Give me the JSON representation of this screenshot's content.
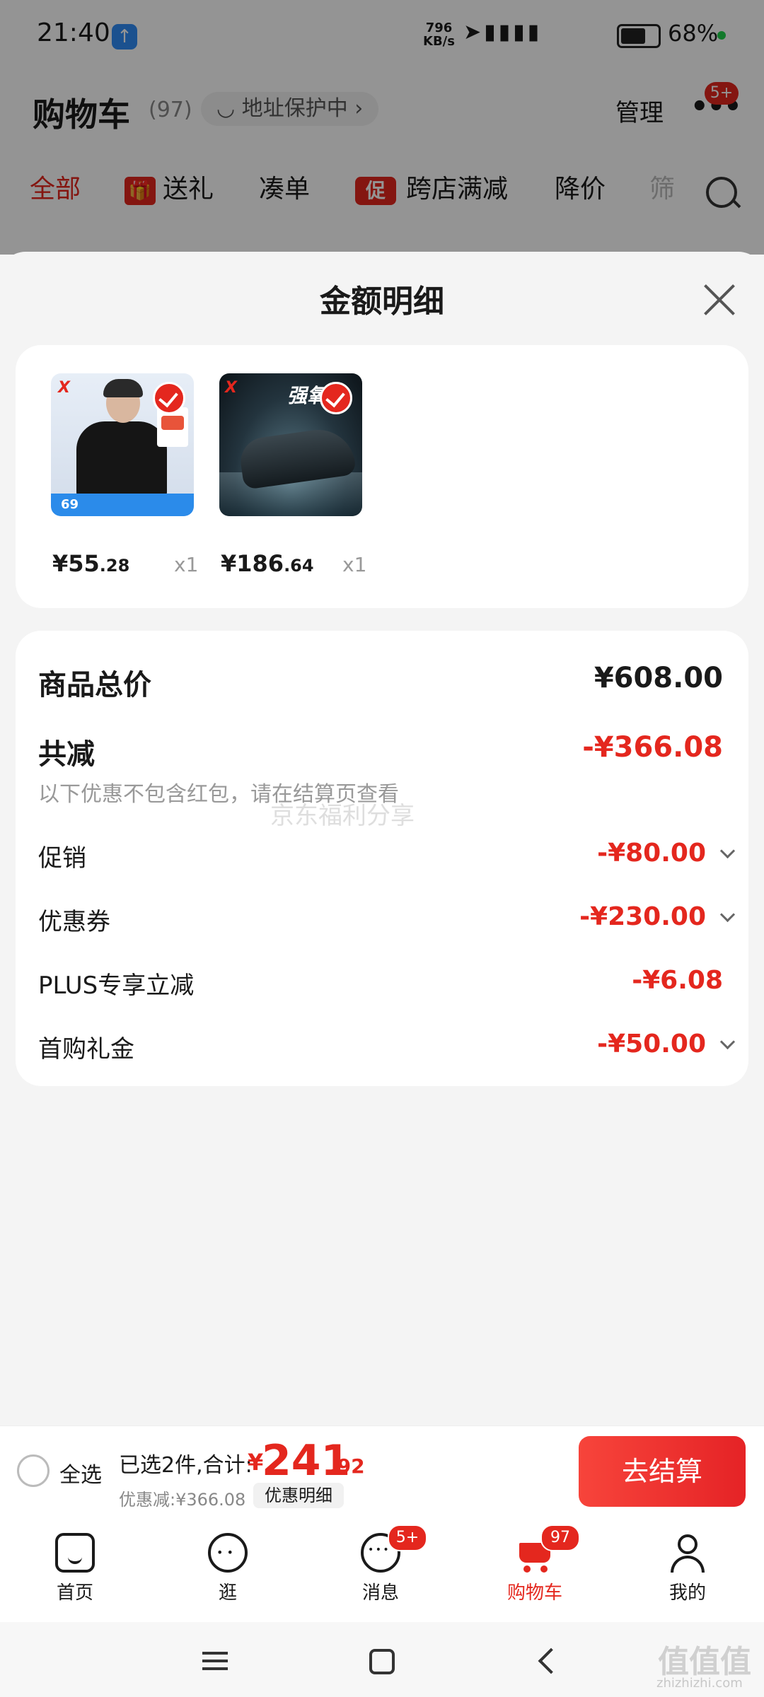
{
  "status_bar": {
    "time": "21:40",
    "net_speed_value": "796",
    "net_speed_unit": "KB/s",
    "battery": "68%"
  },
  "header": {
    "title": "购物车",
    "count": "(97)",
    "address": "地址保护中",
    "manage": "管理",
    "more_badge": "5+"
  },
  "tabs": [
    "全部",
    "送礼",
    "凑单",
    "跨店满减",
    "降价",
    "筛"
  ],
  "tab_icons": {
    "gift": "🎁",
    "promo": "促"
  },
  "sheet": {
    "title": "金额明细",
    "products": [
      {
        "price_int": "¥55",
        "price_dec": ".28",
        "qty": "x1",
        "logo": "X",
        "badge_num": "69"
      },
      {
        "price_int": "¥186",
        "price_dec": ".64",
        "qty": "x1",
        "logo": "X",
        "banner": "强氧"
      }
    ],
    "total_label": "商品总价",
    "total_value": "¥608.00",
    "reduce_label": "共减",
    "reduce_value": "-¥366.08",
    "note": "以下优惠不包含红包，请在结算页查看",
    "watermark": "京东福利分享",
    "discounts": [
      {
        "label": "促销",
        "value": "-¥80.00"
      },
      {
        "label": "优惠券",
        "value": "-¥230.00"
      },
      {
        "label": "PLUS专享立减",
        "value": "-¥6.08"
      },
      {
        "label": "首购礼金",
        "value": "-¥50.00"
      }
    ]
  },
  "checkout": {
    "select_all": "全选",
    "selected_info": "已选2件,合计:",
    "currency": "¥",
    "total_int": "241",
    "total_dec": ".92",
    "discount_info": "优惠减:¥366.08",
    "detail_button": "优惠明细",
    "checkout_button": "去结算"
  },
  "bottom_nav": [
    {
      "label": "首页",
      "icon": "home-icon"
    },
    {
      "label": "逛",
      "icon": "stroll-icon"
    },
    {
      "label": "消息",
      "icon": "message-icon",
      "badge": "5+"
    },
    {
      "label": "购物车",
      "icon": "cart-icon",
      "badge": "97",
      "active": true
    },
    {
      "label": "我的",
      "icon": "profile-icon"
    }
  ],
  "site_watermark": {
    "glyphs": "值值值",
    "domain": "zhizhizhi.com"
  },
  "colors": {
    "accent": "#e4271e",
    "background": "#f4f4f4",
    "card": "#ffffff"
  }
}
